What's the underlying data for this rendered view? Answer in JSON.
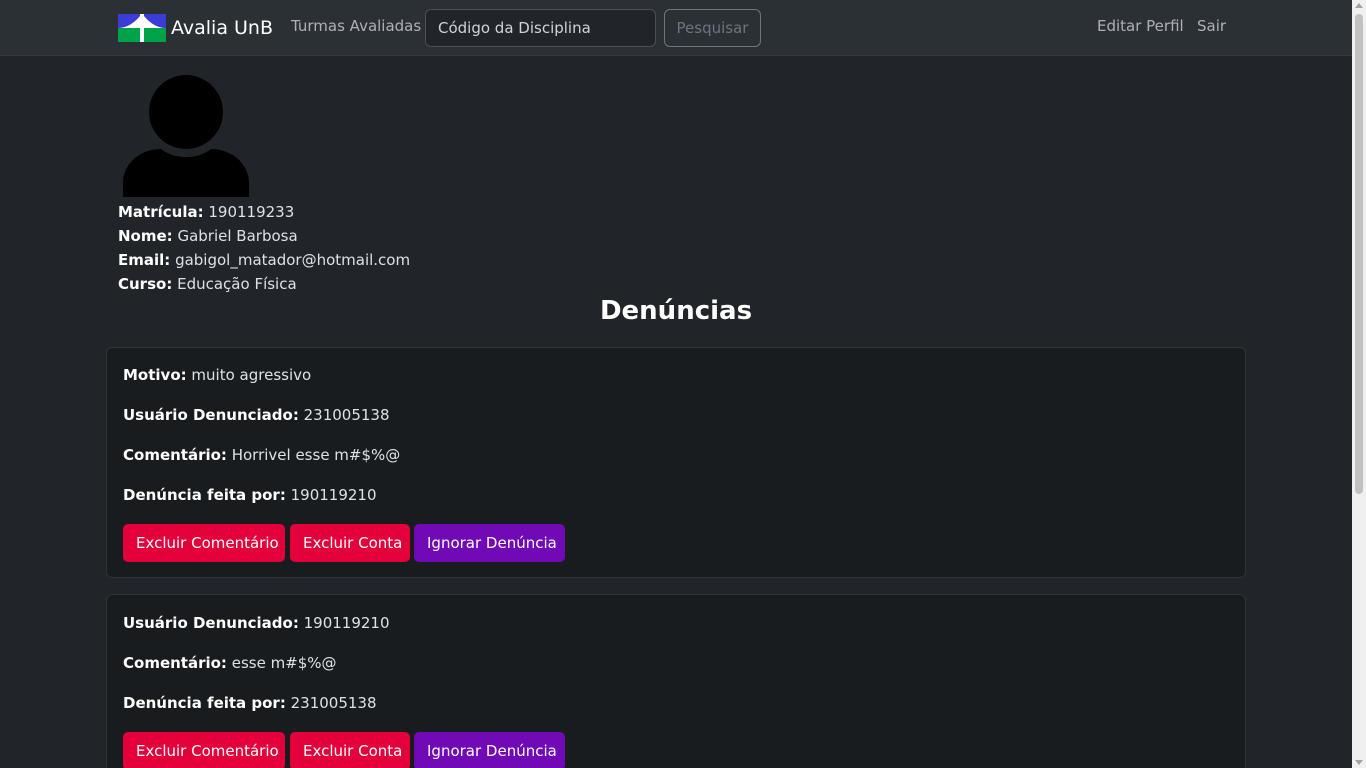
{
  "navbar": {
    "brand": "Avalia UnB",
    "turmas_link": "Turmas Avaliadas",
    "search_placeholder": "Código da Disciplina",
    "search_button": "Pesquisar",
    "edit_profile": "Editar Perfil",
    "logout": "Sair",
    "logo_icon": "unb-logo-icon"
  },
  "profile": {
    "avatar_icon": "user-silhouette-icon",
    "matricula_label": "Matrícula:",
    "matricula": "190119233",
    "nome_label": "Nome:",
    "nome": "Gabriel Barbosa",
    "email_label": "Email:",
    "email": "gabigol_matador@hotmail.com",
    "curso_label": "Curso:",
    "curso": "Educação Física"
  },
  "section_title": "Denúncias",
  "reports": [
    {
      "motivo_label": "Motivo:",
      "motivo": "muito agressivo",
      "usuario_label": "Usuário Denunciado:",
      "usuario": "231005138",
      "comentario_label": "Comentário:",
      "comentario": "Horrivel esse m#$%@",
      "feita_por_label": "Denúncia feita por:",
      "feita_por": "190119210",
      "btn_excluir_comentario": "Excluir Comentário",
      "btn_excluir_conta": "Excluir Conta",
      "btn_ignorar": "Ignorar Denúncia"
    },
    {
      "usuario_label": "Usuário Denunciado:",
      "usuario": "190119210",
      "comentario_label": "Comentário:",
      "comentario": "esse m#$%@",
      "feita_por_label": "Denúncia feita por:",
      "feita_por": "231005138",
      "btn_excluir_comentario": "Excluir Comentário",
      "btn_excluir_conta": "Excluir Conta",
      "btn_ignorar": "Ignorar Denúncia"
    }
  ],
  "colors": {
    "background": "#212529",
    "navbar": "#2b3035",
    "card": "#191c1f",
    "danger": "#e4003a",
    "purple": "#7209b7",
    "logo_blue": "#3b3bd6",
    "logo_green": "#00a34a"
  }
}
